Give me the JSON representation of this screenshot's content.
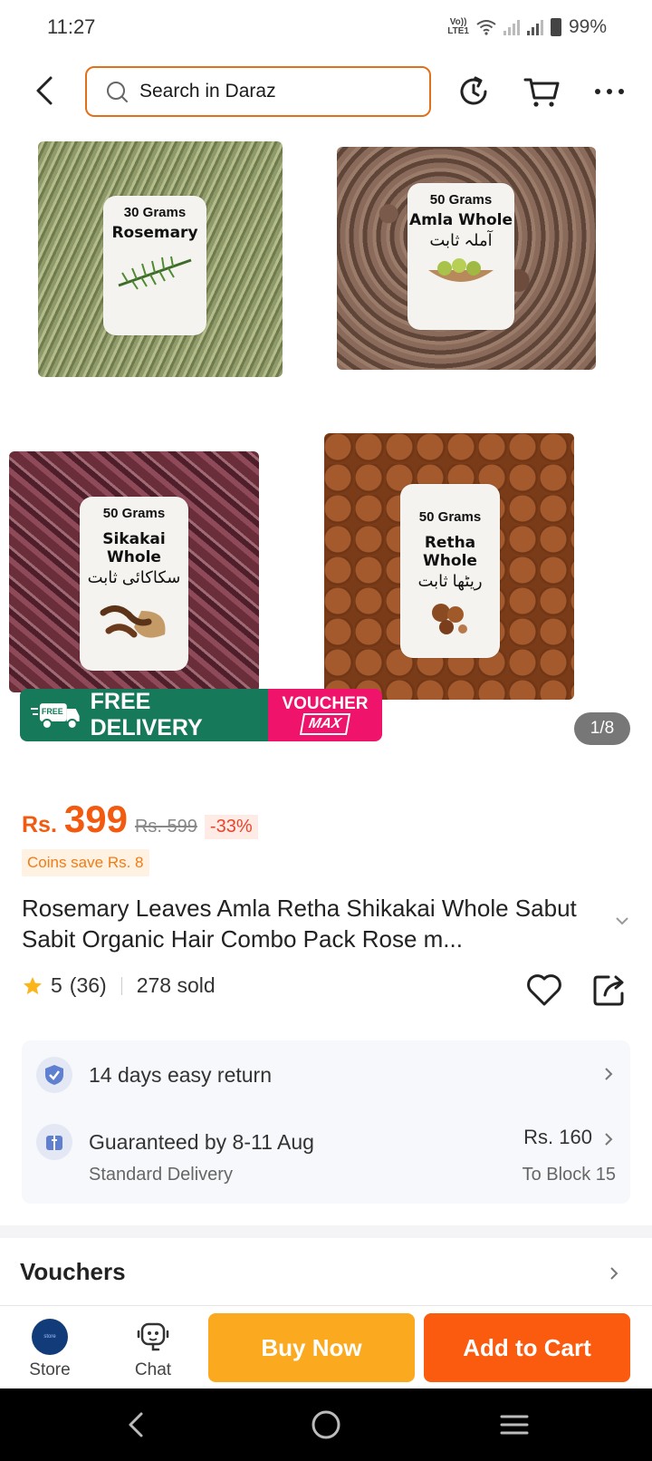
{
  "status_bar": {
    "time": "11:27",
    "volte": "Vo)) LTE1",
    "battery": "99%"
  },
  "header": {
    "search_placeholder": "Search in Daraz",
    "icons": [
      "back-arrow-icon",
      "reload-icon",
      "cart-icon",
      "more-icon"
    ]
  },
  "gallery": {
    "products": [
      {
        "grams": "30 Grams",
        "name": "Rosemary",
        "urdu": ""
      },
      {
        "grams": "50 Grams",
        "name": "Amla Whole",
        "urdu": "آملہ ثابت"
      },
      {
        "grams": "50 Grams",
        "name": "Sikakai Whole",
        "urdu": "سکاکائی ثابت"
      },
      {
        "grams": "50 Grams",
        "name": "Retha Whole",
        "urdu": "ریٹھا ثابت"
      }
    ],
    "promo": {
      "free_badge": "FREE",
      "free_delivery": "FREE DELIVERY",
      "voucher": "VOUCHER",
      "max": "MAX"
    },
    "page_indicator": "1/8"
  },
  "price": {
    "currency": "Rs.",
    "current": "399",
    "original": "Rs. 599",
    "discount": "-33%",
    "coins": "Coins save Rs. 8"
  },
  "product": {
    "title": "Rosemary Leaves Amla Retha Shikakai Whole Sabut Sabit Organic Hair Combo Pack Rose m...",
    "rating": "5",
    "reviews": "(36)",
    "sold": "278 sold"
  },
  "service": {
    "return": "14 days easy return",
    "delivery": "Guaranteed by 8-11 Aug",
    "delivery_type": "Standard Delivery",
    "delivery_price": "Rs. 160",
    "destination": "To Block 15"
  },
  "vouchers": {
    "label": "Vouchers"
  },
  "actions": {
    "store": "Store",
    "chat": "Chat",
    "buy_now": "Buy Now",
    "add_to_cart": "Add to Cart"
  },
  "colors": {
    "brand_orange": "#f25a0f",
    "buy_now": "#fbaa1f",
    "add_to_cart": "#fa5b0f",
    "free_delivery": "#167a5a",
    "voucher_max": "#f0136b"
  }
}
